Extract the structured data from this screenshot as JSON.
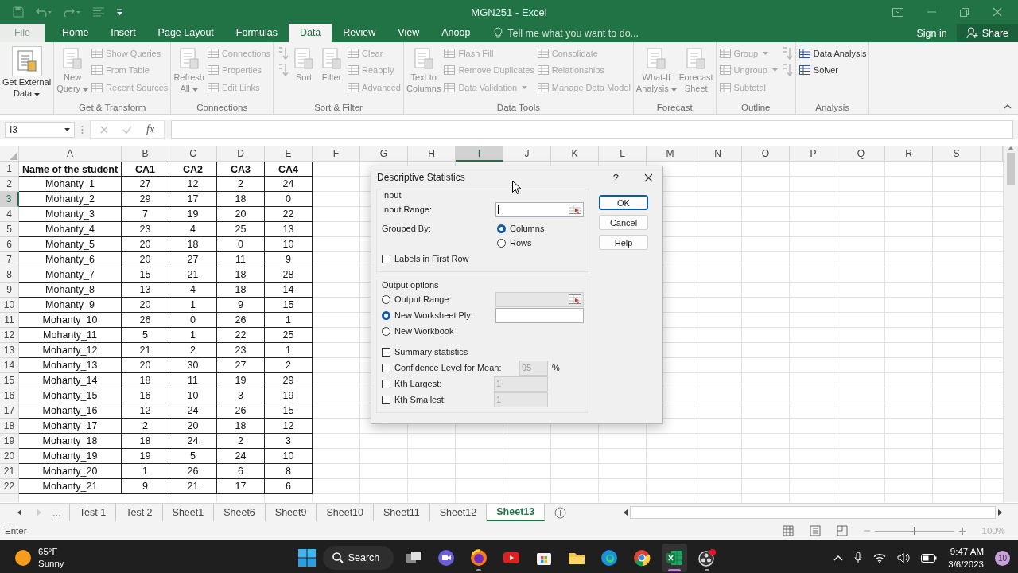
{
  "window": {
    "title": "MGN251 - Excel"
  },
  "file_tab": {
    "label": "File"
  },
  "tabs": [
    {
      "label": "Home",
      "selected": false
    },
    {
      "label": "Insert",
      "selected": false
    },
    {
      "label": "Page Layout",
      "selected": false
    },
    {
      "label": "Formulas",
      "selected": false
    },
    {
      "label": "Data",
      "selected": true
    },
    {
      "label": "Review",
      "selected": false
    },
    {
      "label": "View",
      "selected": false
    },
    {
      "label": "Anoop",
      "selected": false
    }
  ],
  "tell_me": {
    "placeholder": "Tell me what you want to do..."
  },
  "account": {
    "sign_in": "Sign in",
    "share": "Share"
  },
  "ribbon": {
    "groups": [
      {
        "items": [
          {
            "kind": "large",
            "lines": [
              "Get External",
              "Data"
            ],
            "disabled": false,
            "dropdown": true
          }
        ]
      },
      {
        "label": "Get & Transform",
        "items": [
          {
            "kind": "large",
            "lines": [
              "New",
              "Query"
            ],
            "disabled": true,
            "dropdown": true
          },
          {
            "kind": "small",
            "label": "Show Queries",
            "disabled": true,
            "dropdown": false
          },
          {
            "kind": "small",
            "label": "From Table",
            "disabled": true,
            "dropdown": false
          },
          {
            "kind": "small",
            "label": "Recent Sources",
            "disabled": true,
            "dropdown": false
          }
        ]
      },
      {
        "label": "Connections",
        "items": [
          {
            "kind": "large",
            "lines": [
              "Refresh",
              "All"
            ],
            "disabled": true,
            "dropdown": true
          },
          {
            "kind": "small",
            "label": "Connections",
            "disabled": true,
            "dropdown": false
          },
          {
            "kind": "small",
            "label": "Properties",
            "disabled": true,
            "dropdown": false
          },
          {
            "kind": "small",
            "label": "Edit Links",
            "disabled": true,
            "dropdown": false
          }
        ]
      },
      {
        "label": "Sort & Filter",
        "items": [
          {
            "kind": "icon",
            "disabled": true,
            "dropdown": false
          },
          {
            "kind": "icon",
            "disabled": true,
            "dropdown": false
          },
          {
            "kind": "large",
            "lines": [
              "Sort"
            ],
            "disabled": true,
            "dropdown": false
          },
          {
            "kind": "large",
            "lines": [
              "Filter"
            ],
            "disabled": true,
            "dropdown": false
          },
          {
            "kind": "small",
            "label": "Clear",
            "disabled": true,
            "dropdown": false
          },
          {
            "kind": "small",
            "label": "Reapply",
            "disabled": true,
            "dropdown": false
          },
          {
            "kind": "small",
            "label": "Advanced",
            "disabled": true,
            "dropdown": false
          }
        ]
      },
      {
        "label": "Data Tools",
        "items": [
          {
            "kind": "large",
            "lines": [
              "Text to",
              "Columns"
            ],
            "disabled": true,
            "dropdown": false
          },
          {
            "kind": "small",
            "label": "Flash Fill",
            "disabled": true,
            "dropdown": false
          },
          {
            "kind": "small",
            "label": "Remove Duplicates",
            "disabled": true,
            "dropdown": false
          },
          {
            "kind": "small",
            "label": "Data Validation",
            "disabled": true,
            "dropdown": true
          },
          {
            "kind": "small",
            "label": "Consolidate",
            "disabled": true,
            "dropdown": false
          },
          {
            "kind": "small",
            "label": "Relationships",
            "disabled": true,
            "dropdown": false
          },
          {
            "kind": "small",
            "label": "Manage Data Model",
            "disabled": true,
            "dropdown": false
          }
        ]
      },
      {
        "label": "Forecast",
        "items": [
          {
            "kind": "large",
            "lines": [
              "What-If",
              "Analysis"
            ],
            "disabled": true,
            "dropdown": true
          },
          {
            "kind": "large",
            "lines": [
              "Forecast",
              "Sheet"
            ],
            "disabled": true,
            "dropdown": false
          }
        ]
      },
      {
        "label": "Outline",
        "items": [
          {
            "kind": "small",
            "label": "Group",
            "disabled": true,
            "dropdown": true
          },
          {
            "kind": "small",
            "label": "Ungroup",
            "disabled": true,
            "dropdown": true
          },
          {
            "kind": "small",
            "label": "Subtotal",
            "disabled": true,
            "dropdown": false
          },
          {
            "kind": "icon",
            "disabled": true,
            "dropdown": false
          },
          {
            "kind": "icon",
            "disabled": true,
            "dropdown": false
          }
        ]
      },
      {
        "label": "Analysis",
        "items": [
          {
            "kind": "small",
            "label": "Data Analysis",
            "disabled": false,
            "dropdown": false
          },
          {
            "kind": "small",
            "label": "Solver",
            "disabled": false,
            "dropdown": false
          }
        ]
      }
    ]
  },
  "formula_bar": {
    "name_box": "I3",
    "fx": "fx"
  },
  "sheet": {
    "columns": [
      {
        "label": "A",
        "selected": false
      },
      {
        "label": "B",
        "selected": false
      },
      {
        "label": "C",
        "selected": false
      },
      {
        "label": "D",
        "selected": false
      },
      {
        "label": "E",
        "selected": false
      },
      {
        "label": "F",
        "selected": false
      },
      {
        "label": "G",
        "selected": false
      },
      {
        "label": "H",
        "selected": false
      },
      {
        "label": "I",
        "selected": true
      },
      {
        "label": "J",
        "selected": false
      },
      {
        "label": "K",
        "selected": false
      },
      {
        "label": "L",
        "selected": false
      },
      {
        "label": "M",
        "selected": false
      },
      {
        "label": "N",
        "selected": false
      },
      {
        "label": "O",
        "selected": false
      },
      {
        "label": "P",
        "selected": false
      },
      {
        "label": "Q",
        "selected": false
      },
      {
        "label": "R",
        "selected": false
      },
      {
        "label": "S",
        "selected": false
      }
    ],
    "rows": [
      {
        "number": "1",
        "selected": false,
        "kind": "header",
        "cells": [
          "Name of the student",
          "CA1",
          "CA2",
          "CA3",
          "CA4"
        ]
      },
      {
        "number": "2",
        "selected": false,
        "kind": "data",
        "cells": [
          "Mohanty_1",
          "27",
          "12",
          "2",
          "24"
        ]
      },
      {
        "number": "3",
        "selected": true,
        "kind": "data",
        "cells": [
          "Mohanty_2",
          "29",
          "17",
          "18",
          "0"
        ]
      },
      {
        "number": "4",
        "selected": false,
        "kind": "data",
        "cells": [
          "Mohanty_3",
          "7",
          "19",
          "20",
          "22"
        ]
      },
      {
        "number": "5",
        "selected": false,
        "kind": "data",
        "cells": [
          "Mohanty_4",
          "23",
          "4",
          "25",
          "13"
        ]
      },
      {
        "number": "6",
        "selected": false,
        "kind": "data",
        "cells": [
          "Mohanty_5",
          "20",
          "18",
          "0",
          "10"
        ]
      },
      {
        "number": "7",
        "selected": false,
        "kind": "data",
        "cells": [
          "Mohanty_6",
          "20",
          "27",
          "11",
          "9"
        ]
      },
      {
        "number": "8",
        "selected": false,
        "kind": "data",
        "cells": [
          "Mohanty_7",
          "15",
          "21",
          "18",
          "28"
        ]
      },
      {
        "number": "9",
        "selected": false,
        "kind": "data",
        "cells": [
          "Mohanty_8",
          "13",
          "4",
          "18",
          "14"
        ]
      },
      {
        "number": "10",
        "selected": false,
        "kind": "data",
        "cells": [
          "Mohanty_9",
          "20",
          "1",
          "9",
          "15"
        ]
      },
      {
        "number": "11",
        "selected": false,
        "kind": "data",
        "cells": [
          "Mohanty_10",
          "26",
          "0",
          "26",
          "1"
        ]
      },
      {
        "number": "12",
        "selected": false,
        "kind": "data",
        "cells": [
          "Mohanty_11",
          "5",
          "1",
          "22",
          "25"
        ]
      },
      {
        "number": "13",
        "selected": false,
        "kind": "data",
        "cells": [
          "Mohanty_12",
          "21",
          "2",
          "23",
          "1"
        ]
      },
      {
        "number": "14",
        "selected": false,
        "kind": "data",
        "cells": [
          "Mohanty_13",
          "20",
          "30",
          "27",
          "2"
        ]
      },
      {
        "number": "15",
        "selected": false,
        "kind": "data",
        "cells": [
          "Mohanty_14",
          "18",
          "11",
          "19",
          "29"
        ]
      },
      {
        "number": "16",
        "selected": false,
        "kind": "data",
        "cells": [
          "Mohanty_15",
          "16",
          "10",
          "3",
          "19"
        ]
      },
      {
        "number": "17",
        "selected": false,
        "kind": "data",
        "cells": [
          "Mohanty_16",
          "12",
          "24",
          "26",
          "15"
        ]
      },
      {
        "number": "18",
        "selected": false,
        "kind": "data",
        "cells": [
          "Mohanty_17",
          "2",
          "20",
          "18",
          "12"
        ]
      },
      {
        "number": "19",
        "selected": false,
        "kind": "data",
        "cells": [
          "Mohanty_18",
          "18",
          "24",
          "2",
          "3"
        ]
      },
      {
        "number": "20",
        "selected": false,
        "kind": "data",
        "cells": [
          "Mohanty_19",
          "19",
          "5",
          "24",
          "10"
        ]
      },
      {
        "number": "21",
        "selected": false,
        "kind": "data",
        "cells": [
          "Mohanty_20",
          "1",
          "26",
          "6",
          "8"
        ]
      },
      {
        "number": "22",
        "selected": false,
        "kind": "data",
        "cells": [
          "Mohanty_21",
          "9",
          "21",
          "17",
          "6"
        ]
      }
    ]
  },
  "sheet_tabs": {
    "more": "...",
    "tabs": [
      {
        "label": "Test 1",
        "selected": false
      },
      {
        "label": "Test 2",
        "selected": false
      },
      {
        "label": "Sheet1",
        "selected": false
      },
      {
        "label": "Sheet6",
        "selected": false
      },
      {
        "label": "Sheet9",
        "selected": false
      },
      {
        "label": "Sheet10",
        "selected": false
      },
      {
        "label": "Sheet11",
        "selected": false
      },
      {
        "label": "Sheet12",
        "selected": false
      },
      {
        "label": "Sheet13",
        "selected": true
      }
    ]
  },
  "status_bar": {
    "mode": "Enter",
    "zoom": {
      "level": 0.5,
      "reading": "100%"
    }
  },
  "dialog": {
    "title": "Descriptive Statistics",
    "help": "?",
    "input": {
      "heading": "Input",
      "range_label": "Input Range:",
      "focused": true,
      "grouped_label": "Grouped By:",
      "grouped_options": [
        {
          "label": "Columns",
          "selected": true
        },
        {
          "label": "Rows",
          "selected": false
        }
      ],
      "labels_option": {
        "label": "Labels in First Row",
        "checked": false
      }
    },
    "output": {
      "heading": "Output options",
      "destinations": [
        {
          "label": "Output Range:",
          "selected": false,
          "kind": "range",
          "disabled": true
        },
        {
          "label": "New Worksheet Ply:",
          "selected": true,
          "kind": "text",
          "disabled": false
        },
        {
          "label": "New Workbook",
          "selected": false,
          "kind": "none",
          "disabled": false
        }
      ],
      "options": [
        {
          "label": "Summary statistics",
          "checked": false
        },
        {
          "label": "Confidence Level for Mean:",
          "checked": false,
          "value": "95",
          "unit": "%"
        },
        {
          "label": "Kth Largest:",
          "checked": false,
          "value": "1"
        },
        {
          "label": "Kth Smallest:",
          "checked": false,
          "value": "1"
        }
      ]
    },
    "buttons": [
      {
        "label": "OK",
        "default": true
      },
      {
        "label": "Cancel",
        "default": false
      },
      {
        "label": "Help",
        "default": false
      }
    ]
  },
  "taskbar": {
    "weather": {
      "temperature": "65°F",
      "condition": "Sunny"
    },
    "search": {
      "label": "Search"
    },
    "apps": [
      {
        "running": false,
        "active": false
      },
      {
        "running": false,
        "active": false
      },
      {
        "running": true,
        "active": false
      },
      {
        "running": false,
        "active": false
      },
      {
        "running": false,
        "active": false
      },
      {
        "running": false,
        "active": false
      },
      {
        "running": false,
        "active": false
      },
      {
        "running": false,
        "active": false
      },
      {
        "running": true,
        "active": true
      },
      {
        "running": true,
        "active": false
      }
    ],
    "clock": {
      "time": "9:47 AM",
      "date": "3/6/2023"
    },
    "notifications": "10"
  }
}
